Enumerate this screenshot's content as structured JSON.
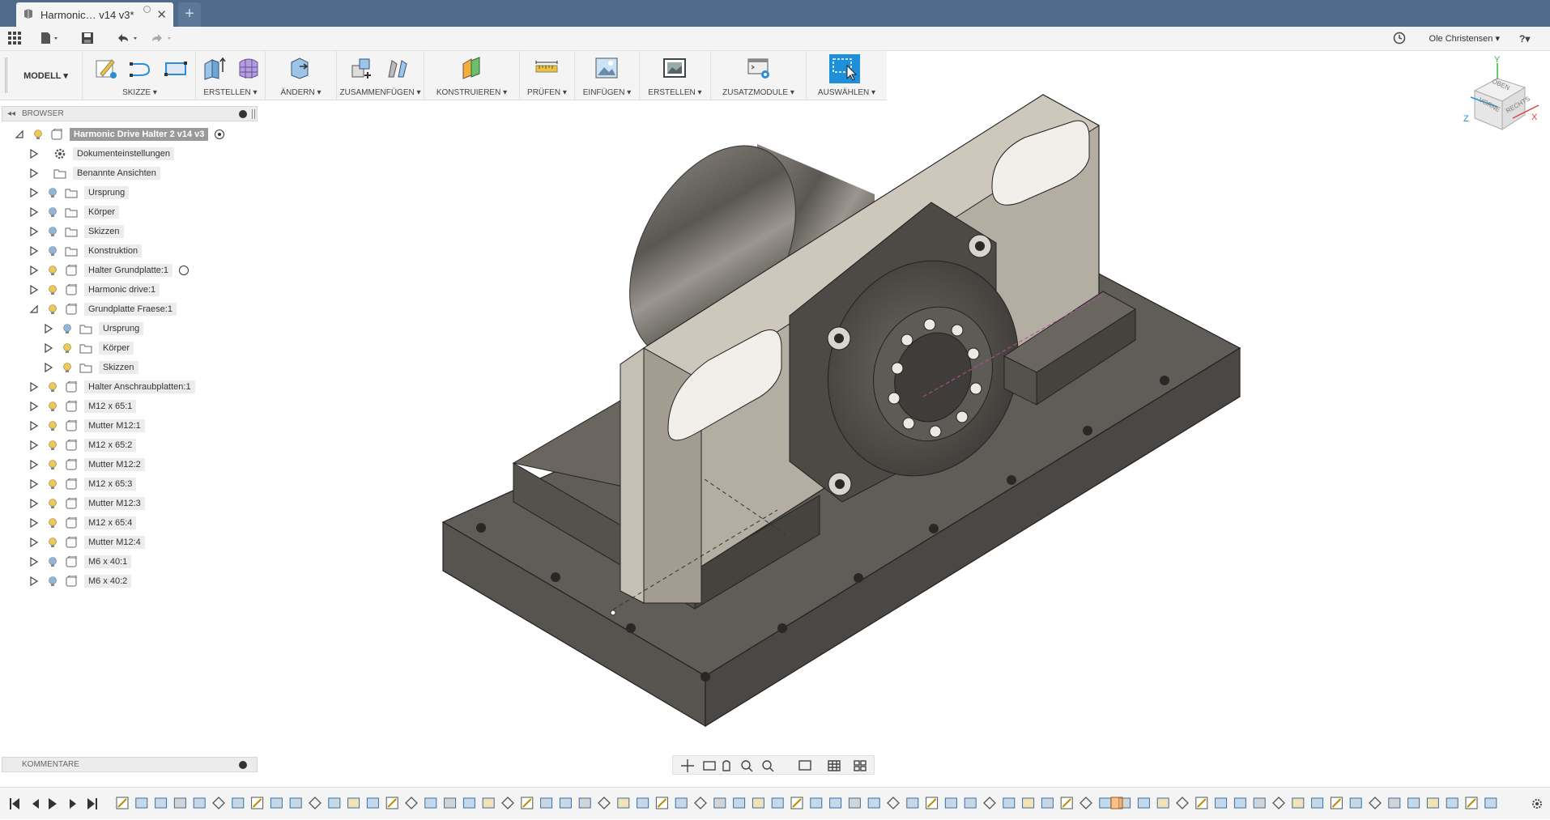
{
  "document_tab": {
    "title": "Harmonic… v14 v3*",
    "close": "✕",
    "new_tab": "+"
  },
  "quick_access": {
    "user": "Ole Christensen ▾",
    "help": "?▾"
  },
  "ribbon": {
    "mode": "MODELL ▾",
    "groups": [
      {
        "label": "SKIZZE ▾"
      },
      {
        "label": "ERSTELLEN ▾"
      },
      {
        "label": "ÄNDERN ▾"
      },
      {
        "label": "ZUSAMMENFÜGEN ▾"
      },
      {
        "label": "KONSTRUIEREN ▾"
      },
      {
        "label": "PRÜFEN ▾"
      },
      {
        "label": "EINFÜGEN ▾"
      },
      {
        "label": "ERSTELLEN ▾"
      },
      {
        "label": "ZUSATZMODULE ▾"
      },
      {
        "label": "AUSWÄHLEN ▾"
      }
    ]
  },
  "viewcube": {
    "top": "OBEN",
    "front": "VORNE",
    "right": "RECHTS",
    "axis_x": "X",
    "axis_y": "Y",
    "axis_z": "Z"
  },
  "browser": {
    "title": "BROWSER",
    "root": "Harmonic Drive Halter 2 v14 v3",
    "items": [
      {
        "label": "Dokumenteinstellungen"
      },
      {
        "label": "Benannte Ansichten"
      },
      {
        "label": "Ursprung"
      },
      {
        "label": "Körper"
      },
      {
        "label": "Skizzen"
      },
      {
        "label": "Konstruktion"
      },
      {
        "label": "Halter Grundplatte:1"
      },
      {
        "label": "Harmonic drive:1"
      },
      {
        "label": "Grundplatte Fraese:1"
      },
      {
        "label": "Ursprung"
      },
      {
        "label": "Körper"
      },
      {
        "label": "Skizzen"
      },
      {
        "label": "Halter Anschraubplatten:1"
      },
      {
        "label": "M12 x 65:1"
      },
      {
        "label": "Mutter M12:1"
      },
      {
        "label": "M12 x 65:2"
      },
      {
        "label": "Mutter M12:2"
      },
      {
        "label": "M12 x 65:3"
      },
      {
        "label": "Mutter M12:3"
      },
      {
        "label": "M12 x 65:4"
      },
      {
        "label": "Mutter M12:4"
      },
      {
        "label": "M6 x 40:1"
      },
      {
        "label": "M6 x 40:2"
      }
    ]
  },
  "comments": {
    "title": "KOMMENTARE"
  },
  "colors": {
    "titlebar": "#4e6b8c",
    "panel": "#f4f4f4",
    "accent": "#2a8fd6",
    "bulb": "#f2c94c",
    "bulb_off": "#8fb6dd",
    "model_dark": "#5a5753",
    "model_light": "#bdb6ab"
  }
}
